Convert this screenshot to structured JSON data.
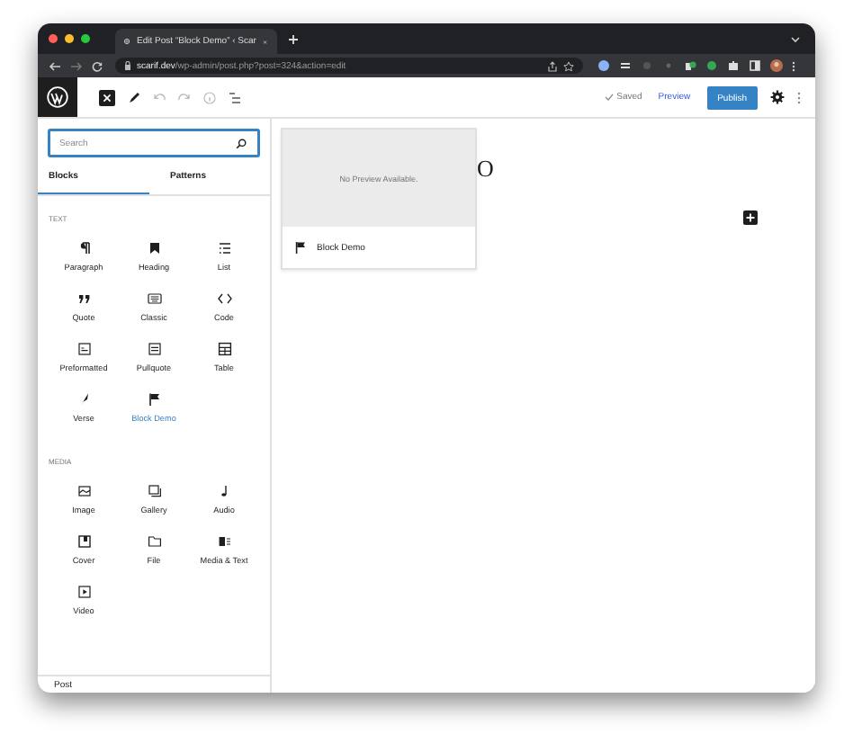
{
  "browser": {
    "tab_title": "Edit Post “Block Demo” ‹ Scar",
    "url_host": "scarif.dev",
    "url_path": "/wp-admin/post.php?post=324&action=edit"
  },
  "toolbar": {
    "saved": "Saved",
    "preview": "Preview",
    "publish": "Publish"
  },
  "inserter": {
    "search": {
      "placeholder": "Search"
    },
    "tabs": [
      {
        "label": "Blocks",
        "selected": true
      },
      {
        "label": "Patterns",
        "selected": false
      }
    ],
    "categories": [
      {
        "name": "TEXT",
        "blocks": [
          {
            "label": "Paragraph",
            "selected": false
          },
          {
            "label": "Heading",
            "selected": false
          },
          {
            "label": "List",
            "selected": false
          },
          {
            "label": "Quote",
            "selected": false
          },
          {
            "label": "Classic",
            "selected": false
          },
          {
            "label": "Code",
            "selected": false
          },
          {
            "label": "Preformatted",
            "selected": false
          },
          {
            "label": "Pullquote",
            "selected": false
          },
          {
            "label": "Table",
            "selected": false
          },
          {
            "label": "Verse",
            "selected": false
          },
          {
            "label": "Block Demo",
            "selected": true
          }
        ]
      },
      {
        "name": "MEDIA",
        "blocks": [
          {
            "label": "Image",
            "selected": false
          },
          {
            "label": "Gallery",
            "selected": false
          },
          {
            "label": "Audio",
            "selected": false
          },
          {
            "label": "Cover",
            "selected": false
          },
          {
            "label": "File",
            "selected": false
          },
          {
            "label": "Media & Text",
            "selected": false
          },
          {
            "label": "Video",
            "selected": false
          }
        ]
      }
    ]
  },
  "preview": {
    "message": "No Preview Available.",
    "block_name": "Block Demo"
  },
  "editor": {
    "title": "O"
  },
  "footer": {
    "breadcrumb": "Post"
  }
}
